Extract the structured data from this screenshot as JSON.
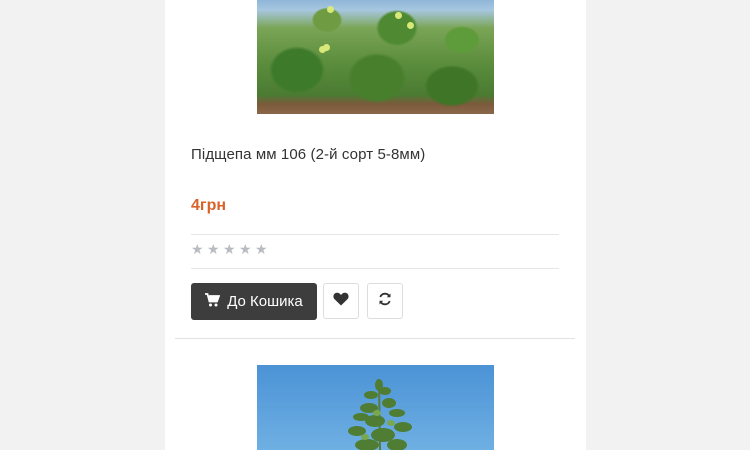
{
  "product": {
    "title": "Підщепа мм 106 (2-й сорт 5-8мм)",
    "price": "4грн",
    "rating": 0,
    "rating_max": 5,
    "add_to_cart_label": "До Кошика",
    "icons": {
      "cart": "shopping-cart-icon",
      "wishlist": "heart-icon",
      "compare": "refresh-icon",
      "star": "star-icon"
    }
  },
  "colors": {
    "price": "#d9622b",
    "cart_button": "#3d3d3d",
    "star_empty": "#b8bcc2"
  }
}
